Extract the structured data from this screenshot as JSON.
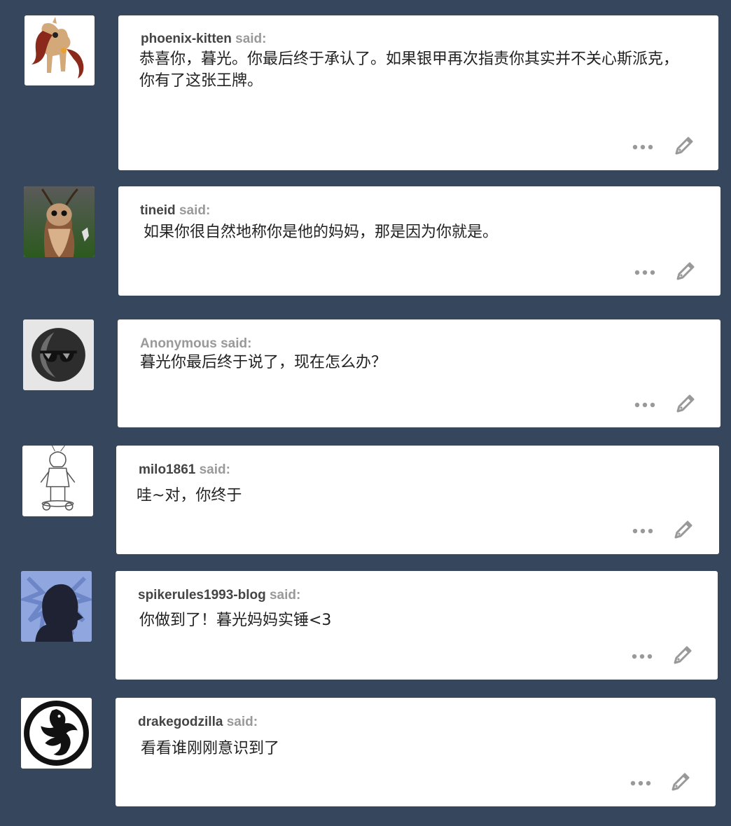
{
  "said_label": "said:",
  "posts": [
    {
      "username": "phoenix-kitten",
      "text_lines": [
        "恭喜你，暮光。你最后终于承认了。如果银甲再次指责你其实并不关心斯派克，",
        "你有了这张王牌。"
      ],
      "avatar": "pony-avatar-icon"
    },
    {
      "username": "tineid",
      "text_lines": [
        "如果你很自然地称你是他的妈妈，那是因为你就是。"
      ],
      "avatar": "moth-avatar-icon"
    },
    {
      "username": "Anonymous",
      "text_lines": [
        "暮光你最后终于说了，现在怎么办？"
      ],
      "avatar": "anonymous-sunglasses-icon"
    },
    {
      "username": "milo1861",
      "text_lines": [
        "哇~对，你终于"
      ],
      "avatar": "sketch-avatar-icon"
    },
    {
      "username": "spikerules1993-blog",
      "text_lines": [
        "你做到了！暮光妈妈实锤<3"
      ],
      "avatar": "silhouette-avatar-icon"
    },
    {
      "username": "drakegodzilla",
      "text_lines": [
        "看看谁刚刚意识到了"
      ],
      "avatar": "dragon-avatar-icon"
    }
  ],
  "colors": {
    "background": "#36465d",
    "card": "#ffffff",
    "username": "#444444",
    "said": "#999999",
    "icon": "#999999"
  },
  "icons": {
    "more": "more-options-icon",
    "edit": "pencil-edit-icon"
  }
}
